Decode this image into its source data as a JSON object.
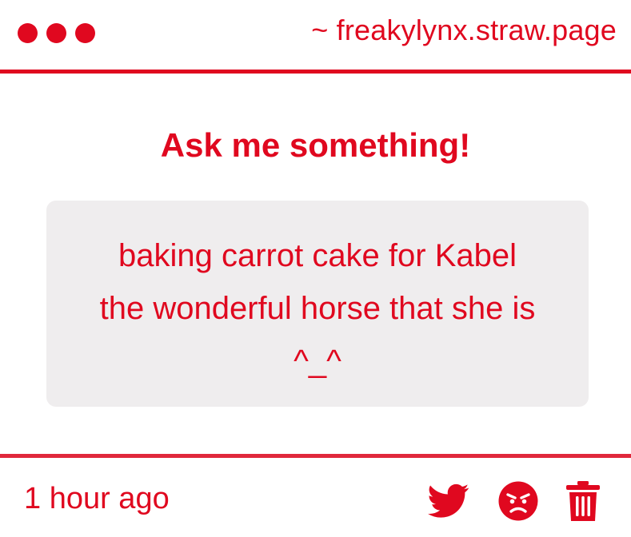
{
  "window": {
    "url": "~ freakylynx.straw.page"
  },
  "main": {
    "heading": "Ask me something!",
    "message": "baking carrot cake for Kabel\nthe wonderful horse that she is\n^_^"
  },
  "footer": {
    "timestamp": "1 hour ago",
    "actions": [
      {
        "icon": "twitter-icon"
      },
      {
        "icon": "angry-face-icon"
      },
      {
        "icon": "trash-icon"
      }
    ]
  },
  "colors": {
    "accent": "#e0081f",
    "message_bg": "#efedee",
    "background": "#ffffff"
  }
}
